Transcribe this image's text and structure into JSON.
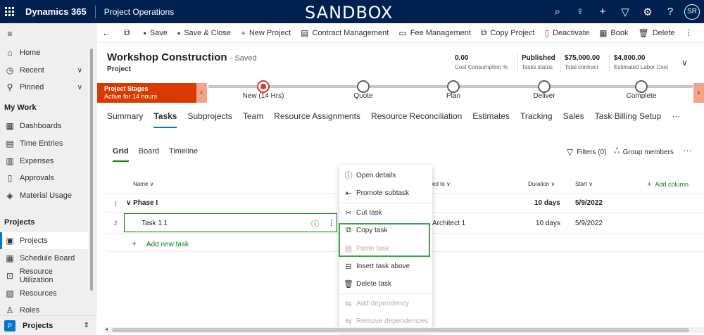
{
  "topbar": {
    "app_name": "Dynamics 365",
    "area_name": "Project Operations",
    "environment": "SANDBOX",
    "avatar": "SR"
  },
  "sidebar": {
    "items": [
      {
        "label": "Home",
        "icon": "home-icon"
      },
      {
        "label": "Recent",
        "icon": "clock-icon"
      },
      {
        "label": "Pinned",
        "icon": "pin-icon"
      }
    ],
    "section_mywork": "My Work",
    "mywork_items": [
      {
        "label": "Dashboards"
      },
      {
        "label": "Time Entries"
      },
      {
        "label": "Expenses"
      },
      {
        "label": "Approvals"
      },
      {
        "label": "Material Usage"
      }
    ],
    "section_projects": "Projects",
    "project_items": [
      {
        "label": "Projects"
      },
      {
        "label": "Schedule Board"
      },
      {
        "label": "Resource Utilization"
      },
      {
        "label": "Resources"
      },
      {
        "label": "Roles"
      }
    ],
    "area_badge": "P",
    "area_label": "Projects"
  },
  "commands": {
    "save": "Save",
    "save_close": "Save & Close",
    "new_project": "New Project",
    "contract_mgmt": "Contract Management",
    "fee_mgmt": "Fee Management",
    "copy_project": "Copy Project",
    "deactivate": "Deactivate",
    "book": "Book",
    "delete": "Delete"
  },
  "record": {
    "title": "Workshop Construction",
    "saved": "- Saved",
    "entity": "Project",
    "fields": [
      {
        "value": "0.00",
        "label": "Cost Consumption %"
      },
      {
        "value": "Published",
        "label": "Tasks status"
      },
      {
        "value": "$75,000.00",
        "label": "Total contract"
      },
      {
        "value": "$4,800.00",
        "label": "Estimated Labor Cost"
      }
    ]
  },
  "bpf": {
    "title": "Project Stages",
    "subtitle": "Active for 14 hours",
    "stages": [
      "New  (14 Hrs)",
      "Quote",
      "Plan",
      "Deliver",
      "Complete"
    ]
  },
  "tabs": [
    "Summary",
    "Tasks",
    "Subprojects",
    "Team",
    "Resource Assignments",
    "Resource Reconciliation",
    "Estimates",
    "Tracking",
    "Sales",
    "Task Billing Setup",
    "···"
  ],
  "subtabs": [
    "Grid",
    "Board",
    "Timeline"
  ],
  "toolbar": {
    "filters": "Filters (0)",
    "group_members": "Group members",
    "more": "···"
  },
  "grid": {
    "headers": {
      "name": "Name",
      "assigned": "ed to",
      "duration": "Duration",
      "start": "Start",
      "add_column": "Add column"
    },
    "rows": [
      {
        "num": "1",
        "name": "Phase I",
        "assigned": "",
        "duration": "10 days",
        "start": "5/9/2022"
      },
      {
        "num": "2",
        "name": "Task 1.1",
        "assigned": "Architect 1",
        "duration": "10 days",
        "start": "5/9/2022"
      }
    ],
    "add_new_task": "Add new task"
  },
  "context_menu": {
    "items": [
      {
        "label": "Open details",
        "icon": "info-icon"
      },
      {
        "label": "Promote subtask",
        "icon": "promote-icon"
      },
      {
        "label": "Cut task",
        "icon": "scissors-icon"
      },
      {
        "label": "Copy task",
        "icon": "copy-icon"
      },
      {
        "label": "Paste task",
        "icon": "paste-icon"
      },
      {
        "label": "Insert task above",
        "icon": "insert-above-icon"
      },
      {
        "label": "Delete task",
        "icon": "trash-icon"
      },
      {
        "label": "Add dependency",
        "icon": "link-icon"
      },
      {
        "label": "Remove dependencies",
        "icon": "unlink-icon"
      }
    ]
  },
  "colors": {
    "topbar": "#002050",
    "accent": "#0078d4",
    "green": "#107c10",
    "stage": "#d83b01"
  }
}
